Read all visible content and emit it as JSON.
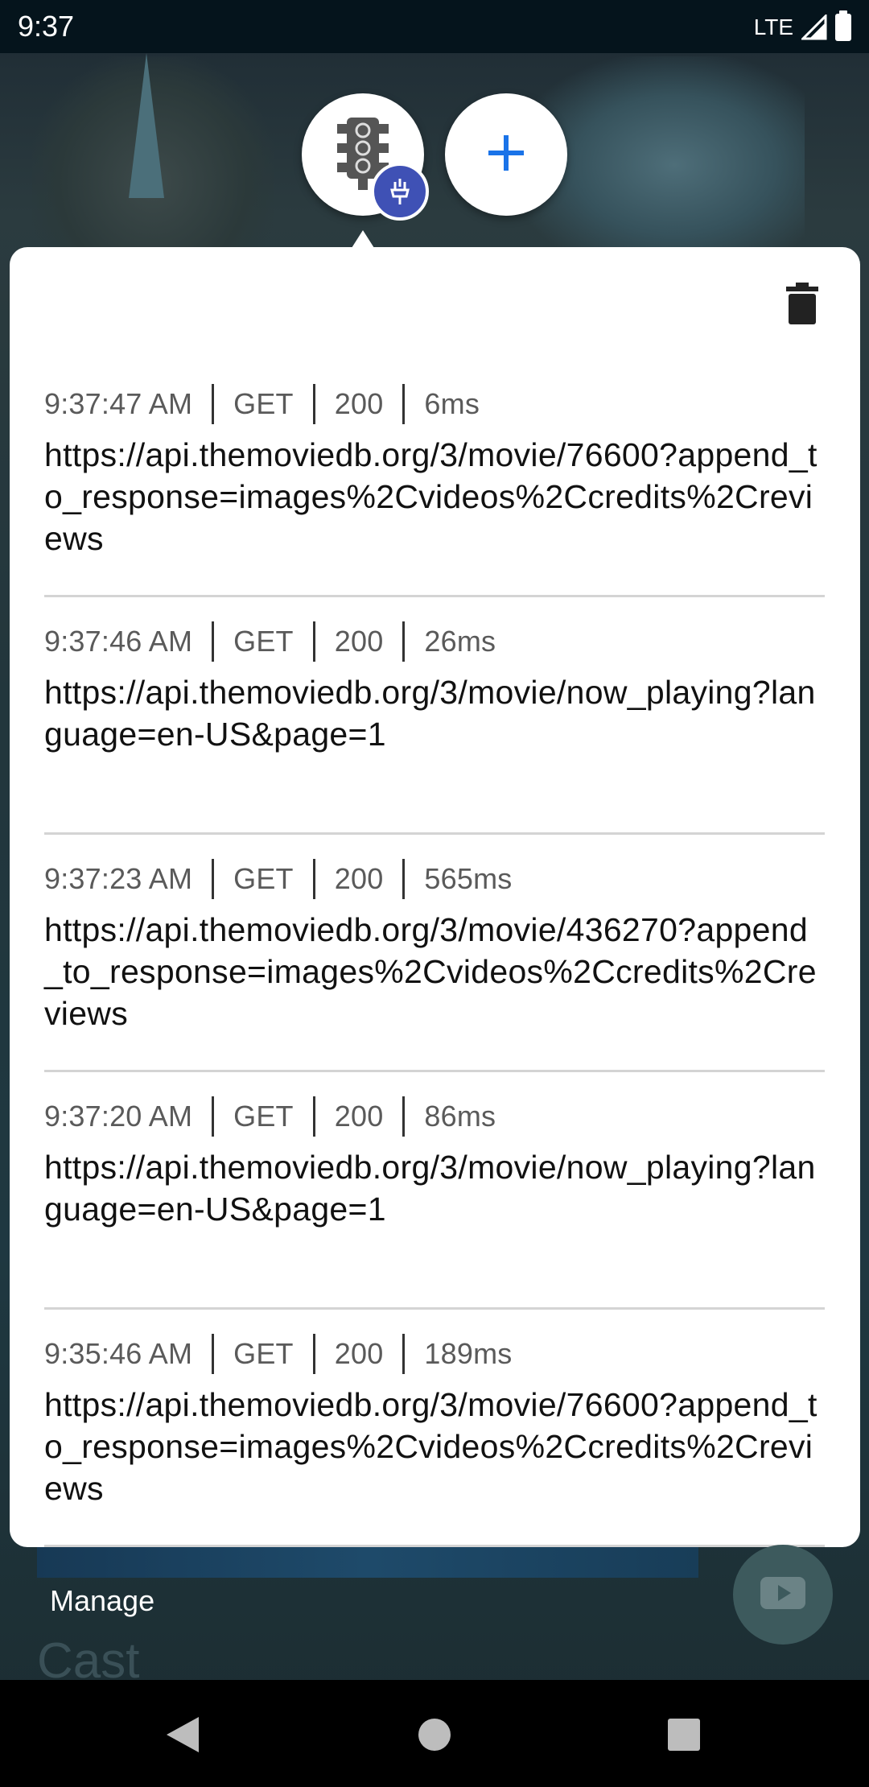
{
  "status_bar": {
    "time": "9:37",
    "network": "LTE"
  },
  "panel": {
    "transactions": [
      {
        "time": "9:37:47 AM",
        "method": "GET",
        "status": "200",
        "duration": "6ms",
        "url": "https://api.themoviedb.org/3/movie/76600?append_to_response=images%2Cvideos%2Ccredits%2Creviews"
      },
      {
        "time": "9:37:46 AM",
        "method": "GET",
        "status": "200",
        "duration": "26ms",
        "url": "https://api.themoviedb.org/3/movie/now_playing?language=en-US&page=1"
      },
      {
        "time": "9:37:23 AM",
        "method": "GET",
        "status": "200",
        "duration": "565ms",
        "url": "https://api.themoviedb.org/3/movie/436270?append_to_response=images%2Cvideos%2Ccredits%2Creviews"
      },
      {
        "time": "9:37:20 AM",
        "method": "GET",
        "status": "200",
        "duration": "86ms",
        "url": "https://api.themoviedb.org/3/movie/now_playing?language=en-US&page=1"
      },
      {
        "time": "9:35:46 AM",
        "method": "GET",
        "status": "200",
        "duration": "189ms",
        "url": "https://api.themoviedb.org/3/movie/76600?append_to_response=images%2Cvideos%2Ccredits%2Creviews"
      }
    ]
  },
  "background": {
    "manage_label": "Manage",
    "cast_heading": "Cast"
  },
  "icons": {
    "chucker_bubble": "traffic-light-icon",
    "badge": "plugin-badge-icon",
    "add": "plus-icon",
    "clear": "trash-icon",
    "play": "play-icon",
    "nav_back": "back-triangle-icon",
    "nav_home": "home-circle-icon",
    "nav_recents": "recents-square-icon"
  },
  "colors": {
    "accent": "#1a73e8",
    "badge": "#3f51b5",
    "status_bar": "#05141c"
  }
}
